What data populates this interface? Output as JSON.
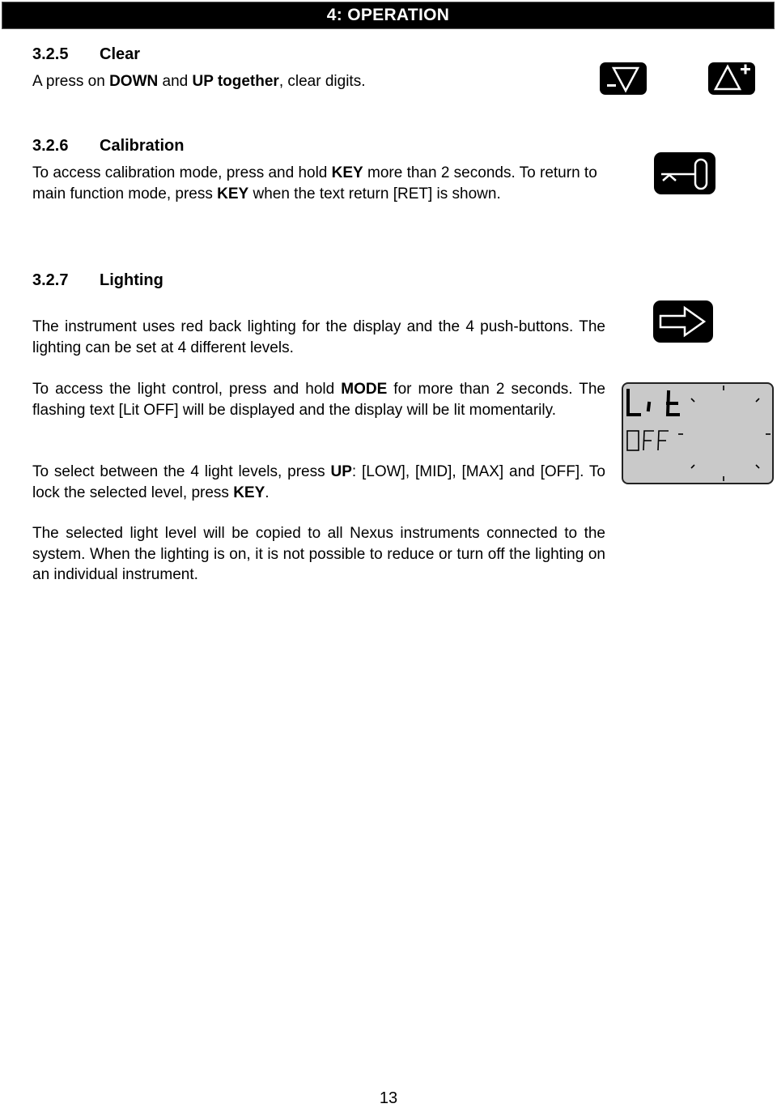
{
  "header": {
    "title": "4:  OPERATION"
  },
  "sections": [
    {
      "number": "3.2.5",
      "title": "Clear",
      "paragraphs": [
        [
          {
            "t": "A press on ",
            "b": false
          },
          {
            "t": "DOWN",
            "b": true
          },
          {
            "t": " and ",
            "b": false
          },
          {
            "t": "UP together",
            "b": true
          },
          {
            "t": ", clear digits.",
            "b": false
          }
        ]
      ]
    },
    {
      "number": "3.2.6",
      "title": "Calibration",
      "paragraphs": [
        [
          {
            "t": "To access calibration mode, press and hold ",
            "b": false
          },
          {
            "t": "KEY",
            "b": true
          },
          {
            "t": " more than 2 seconds. To return to main function mode, press ",
            "b": false
          },
          {
            "t": "KEY",
            "b": true
          },
          {
            "t": " when the text return [RET] is shown.",
            "b": false
          }
        ]
      ]
    },
    {
      "number": "3.2.7",
      "title": "Lighting",
      "paragraphs": [
        [
          {
            "t": "The instrument uses red back lighting for the display and the 4 push-buttons. The lighting can be set at 4 different levels.",
            "b": false
          }
        ],
        [
          {
            "t": "To access the light control, press and hold ",
            "b": false
          },
          {
            "t": "MODE",
            "b": true
          },
          {
            "t": " for more than 2 seconds. The flashing text [Lit OFF] will be displayed and the display will be lit momentarily.",
            "b": false
          }
        ],
        [
          {
            "t": "To select between the 4 light levels, press ",
            "b": false
          },
          {
            "t": "UP",
            "b": true
          },
          {
            "t": ": [LOW], [MID], [MAX] and [OFF].  To lock the selected level, press ",
            "b": false
          },
          {
            "t": "KEY",
            "b": true
          },
          {
            "t": ".",
            "b": false
          }
        ],
        [
          {
            "t": "The selected light level will be copied to all Nexus instruments connected to the system. When the lighting is on, it is not possible to reduce or turn off the lighting on an individual instrument.",
            "b": false
          }
        ]
      ]
    }
  ],
  "icons": {
    "down": "down-minus-button-icon",
    "up": "up-plus-button-icon",
    "key": "key-button-icon",
    "mode": "mode-arrow-button-icon"
  },
  "lcd": {
    "line1": "Lit",
    "line2": "OFF"
  },
  "footer": {
    "page_number": "13"
  }
}
